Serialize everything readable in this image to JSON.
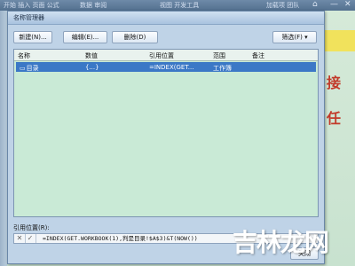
{
  "background": {
    "ribbon_texts": [
      "开始 插入 页面 公式",
      "数据 审阅",
      "视图 开发工具",
      "加载项 团队"
    ],
    "red_chars": [
      "接",
      "任"
    ],
    "window_controls": [
      "⌂",
      "—",
      "✕"
    ]
  },
  "dialog": {
    "title": "名称管理器",
    "toolbar": {
      "new_label": "新建(N)...",
      "edit_label": "编辑(E)...",
      "delete_label": "删除(D)",
      "filter_label": "筛选(F) ▾"
    },
    "list": {
      "columns": [
        "名称",
        "数值",
        "引用位置",
        "范围",
        "备注"
      ],
      "rows": [
        {
          "icon": "name-icon",
          "name": "目录",
          "value": "{...}",
          "refers_to": "=INDEX(GET...",
          "scope": "工作簿",
          "comment": ""
        }
      ]
    },
    "refers_to_label": "引用位置(R):",
    "refers_to_value": "=INDEX(GET.WORKBOOK(1),判是目录!$A$3)&T(NOW())",
    "close_label": "关闭"
  },
  "watermark": {
    "text": "吉林龙网"
  },
  "colors": {
    "selection": "#3b78c6",
    "list_bg": "#c9ead6",
    "dialog_bg": "#bfd3e7",
    "accent_yellow": "#f1e25c",
    "accent_red": "#c23a2a"
  }
}
